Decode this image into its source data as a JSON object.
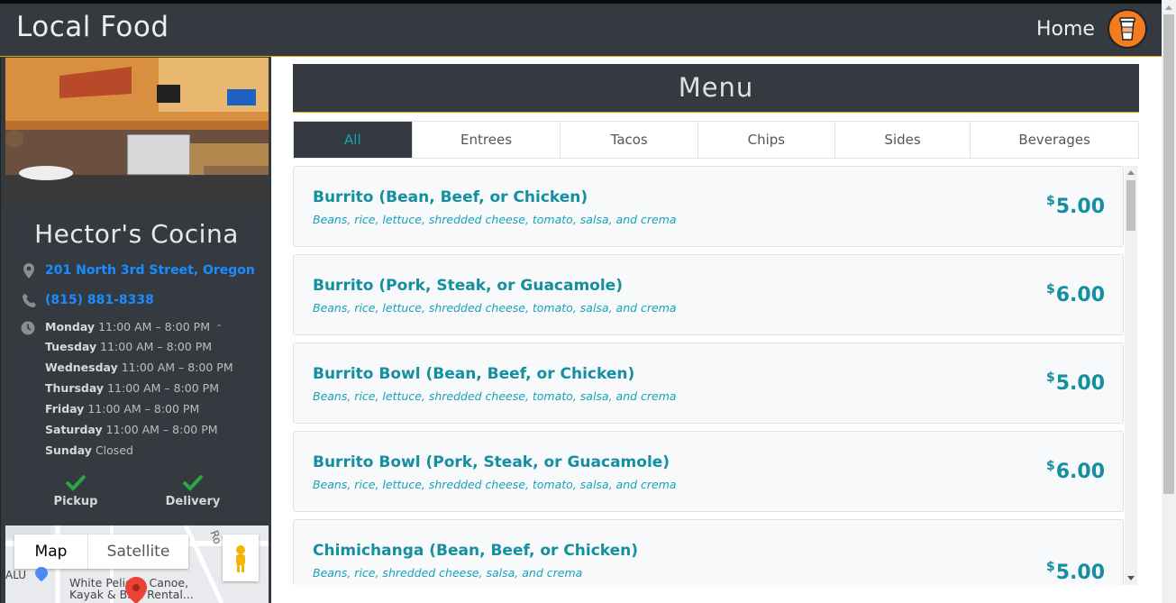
{
  "nav": {
    "brand": "Local Food",
    "home": "Home",
    "cup_icon": "coffee-cup-icon",
    "accent": "#f47c20"
  },
  "restaurant": {
    "name": "Hector's Cocina",
    "address": "201 North 3rd Street, Oregon",
    "phone": "(815) 881-8338",
    "hours": [
      {
        "day": "Monday",
        "time": "11:00 AM – 8:00 PM"
      },
      {
        "day": "Tuesday",
        "time": "11:00 AM – 8:00 PM"
      },
      {
        "day": "Wednesday",
        "time": "11:00 AM – 8:00 PM"
      },
      {
        "day": "Thursday",
        "time": "11:00 AM – 8:00 PM"
      },
      {
        "day": "Friday",
        "time": "11:00 AM – 8:00 PM"
      },
      {
        "day": "Saturday",
        "time": "11:00 AM – 8:00 PM"
      },
      {
        "day": "Sunday",
        "time": "Closed"
      }
    ],
    "services": {
      "pickup": "Pickup",
      "delivery": "Delivery"
    }
  },
  "map": {
    "map_option": "Map",
    "satellite_option": "Satellite",
    "place_label": "White Pelican Canoe, Kayak & Bike Rental...",
    "side_label": "ALU",
    "road_label": "Ro"
  },
  "menu": {
    "title": "Menu",
    "tabs": [
      "All",
      "Entrees",
      "Tacos",
      "Chips",
      "Sides",
      "Beverages"
    ],
    "active_tab": "All",
    "items": [
      {
        "name": "Burrito (Bean, Beef, or Chicken)",
        "desc": "Beans, rice, lettuce, shredded cheese, tomato, salsa, and crema",
        "currency": "$",
        "price": "5.00"
      },
      {
        "name": "Burrito (Pork, Steak, or Guacamole)",
        "desc": "Beans, rice, lettuce, shredded cheese, tomato, salsa, and crema",
        "currency": "$",
        "price": "6.00"
      },
      {
        "name": "Burrito Bowl (Bean, Beef, or Chicken)",
        "desc": "Beans, rice, lettuce, shredded cheese, tomato, salsa, and crema",
        "currency": "$",
        "price": "5.00"
      },
      {
        "name": "Burrito Bowl (Pork, Steak, or Guacamole)",
        "desc": "Beans, rice, lettuce, shredded cheese, tomato, salsa, and crema",
        "currency": "$",
        "price": "6.00"
      },
      {
        "name": "Chimichanga (Bean, Beef, or Chicken)",
        "desc": "Beans, rice, shredded cheese, salsa, and crema",
        "currency": "$",
        "price": "5.00"
      }
    ]
  }
}
